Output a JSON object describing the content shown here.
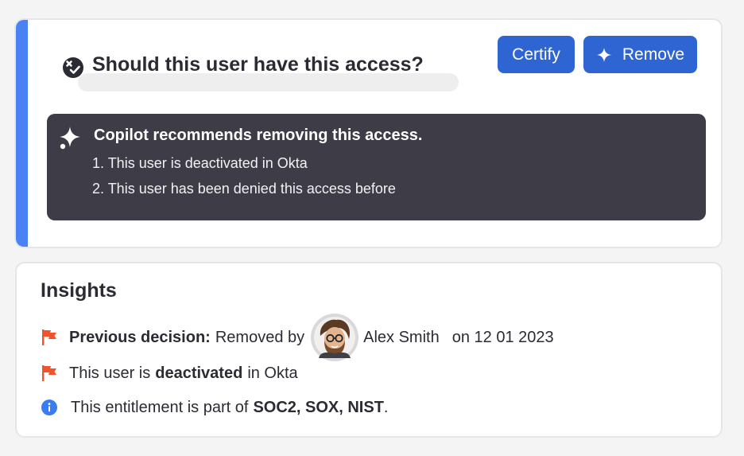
{
  "review": {
    "question": "Should this user have this access?",
    "certify_label": "Certify",
    "remove_label": "Remove",
    "recommendation": {
      "title": "Copilot recommends removing this access.",
      "items": [
        "1. This user is deactivated in Okta",
        "2. This user has been denied this access before"
      ]
    }
  },
  "insights": {
    "title": "Insights",
    "previous_decision": {
      "label": "Previous decision:",
      "text": "Removed by",
      "user_name": "Alex Smith",
      "date_text": "on 12 01 2023"
    },
    "status": {
      "prefix": "This user is",
      "emphasis": "deactivated",
      "suffix": "in Okta"
    },
    "compliance": {
      "prefix": "This entitlement is part of",
      "frameworks": "SOC2, SOX, NIST",
      "suffix": "."
    }
  },
  "colors": {
    "accent": "#4a82f5",
    "button": "#2f64d3",
    "recommendation_bg": "#3d3c47",
    "flag": "#f0532d",
    "info": "#3b7df0"
  },
  "icons": {
    "question": "no-access-badge-icon",
    "copilot": "sparkle-icon",
    "flag": "flag-icon",
    "info": "info-icon"
  }
}
